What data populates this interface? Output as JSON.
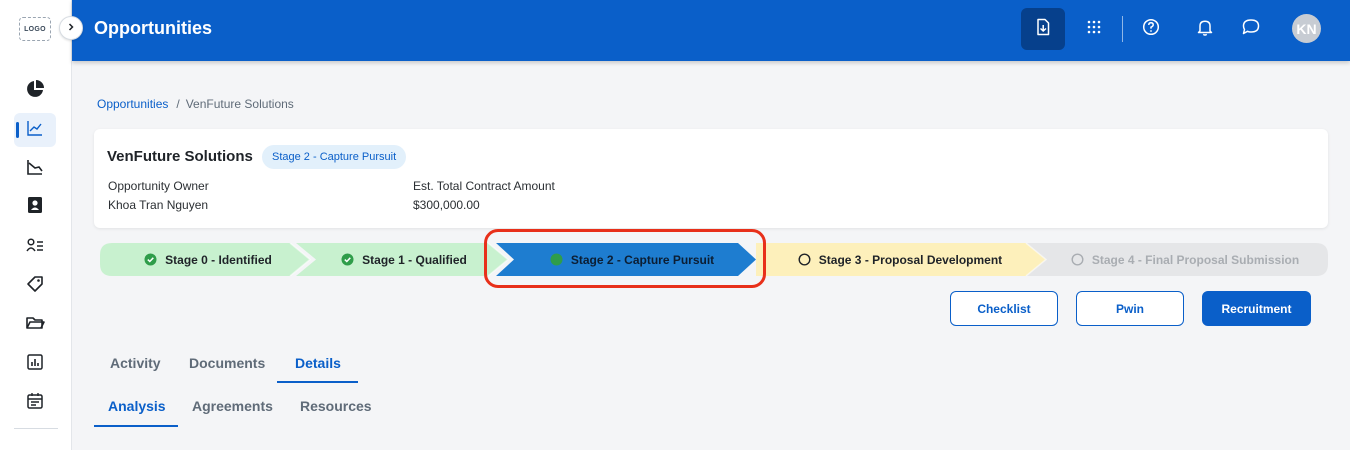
{
  "rail": {
    "logo_text": "LOGO",
    "items": [
      {
        "name": "pie-chart-icon",
        "active": false
      },
      {
        "name": "line-chart-icon",
        "active": true
      },
      {
        "name": "area-chart-icon",
        "active": false
      },
      {
        "name": "contact-book-icon",
        "active": false
      },
      {
        "name": "people-list-icon",
        "active": false
      },
      {
        "name": "tag-icon",
        "active": false
      },
      {
        "name": "folder-icon",
        "active": false
      },
      {
        "name": "bar-report-icon",
        "active": false
      },
      {
        "name": "calendar-icon",
        "active": false
      }
    ]
  },
  "topbar": {
    "title": "Opportunities",
    "icons": [
      "download-file-icon",
      "apps-grid-icon",
      "help-icon",
      "bell-icon",
      "chat-icon"
    ],
    "avatar_initials": "KN"
  },
  "breadcrumb": {
    "parent": "Opportunities",
    "separator": "/",
    "current": "VenFuture Solutions"
  },
  "opportunity": {
    "name": "VenFuture Solutions",
    "stage_badge": "Stage 2 - Capture Pursuit",
    "owner_label": "Opportunity Owner",
    "owner_value": "Khoa Tran Nguyen",
    "amount_label": "Est. Total Contract Amount",
    "amount_value": "$300,000.00"
  },
  "stages": [
    {
      "label": "Stage 0 - Identified",
      "status": "complete"
    },
    {
      "label": "Stage 1 - Qualified",
      "status": "complete"
    },
    {
      "label": "Stage 2 - Capture Pursuit",
      "status": "current"
    },
    {
      "label": "Stage 3 - Proposal Development",
      "status": "next"
    },
    {
      "label": "Stage 4 - Final Proposal Submission",
      "status": "disabled"
    }
  ],
  "actions": {
    "checklist": "Checklist",
    "pwin": "Pwin",
    "recruitment": "Recruitment"
  },
  "tabs": {
    "primary": [
      "Activity",
      "Documents",
      "Details"
    ],
    "primary_active": "Details",
    "secondary": [
      "Analysis",
      "Agreements",
      "Resources"
    ],
    "secondary_active": "Analysis"
  },
  "colors": {
    "brand": "#0a5fc9",
    "complete_stage": "#c8f1cf",
    "current_stage": "#1e7dd0",
    "next_stage": "#fdf0bb",
    "disabled_stage": "#e5e6e8",
    "highlight": "#e8301a"
  }
}
